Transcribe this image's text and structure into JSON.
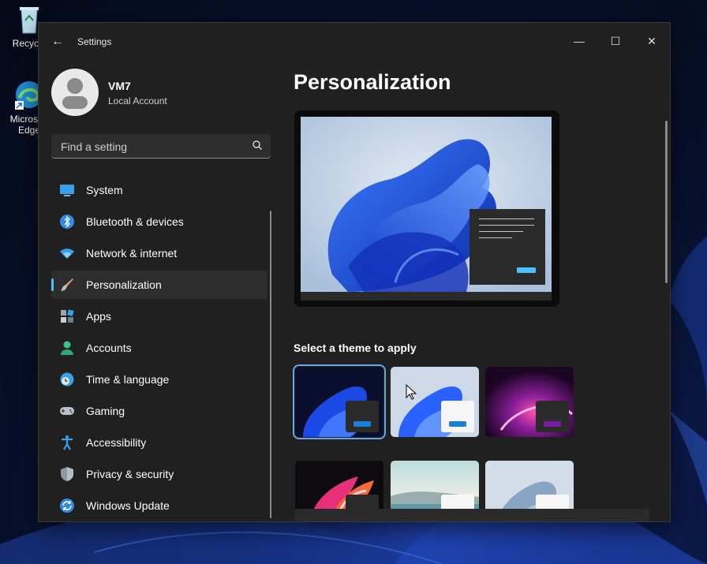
{
  "desktop": {
    "icons": [
      {
        "label": "Recycle",
        "icon": "recycle-bin-icon"
      },
      {
        "label": "Microsoft Edge",
        "icon": "edge-icon"
      }
    ]
  },
  "window": {
    "title": "Settings",
    "controls": {
      "minimize": "—",
      "maximize": "☐",
      "close": "✕"
    }
  },
  "user": {
    "name": "VM7",
    "account_type": "Local Account"
  },
  "search": {
    "placeholder": "Find a setting",
    "value": ""
  },
  "sidebar": {
    "active": "Personalization",
    "items": [
      {
        "label": "System",
        "icon": "system-icon"
      },
      {
        "label": "Bluetooth & devices",
        "icon": "bluetooth-icon"
      },
      {
        "label": "Network & internet",
        "icon": "wifi-icon"
      },
      {
        "label": "Personalization",
        "icon": "brush-icon"
      },
      {
        "label": "Apps",
        "icon": "apps-icon"
      },
      {
        "label": "Accounts",
        "icon": "person-icon"
      },
      {
        "label": "Time & language",
        "icon": "clock-globe-icon"
      },
      {
        "label": "Gaming",
        "icon": "gamepad-icon"
      },
      {
        "label": "Accessibility",
        "icon": "accessibility-icon"
      },
      {
        "label": "Privacy & security",
        "icon": "shield-icon"
      },
      {
        "label": "Windows Update",
        "icon": "update-icon"
      }
    ]
  },
  "main": {
    "title": "Personalization",
    "themes_label": "Select a theme to apply",
    "themes": [
      {
        "style": "windows-dark",
        "selected": true
      },
      {
        "style": "windows-light",
        "selected": false
      },
      {
        "style": "glow",
        "selected": false
      },
      {
        "style": "captured-motion",
        "selected": false
      },
      {
        "style": "sunrise",
        "selected": false
      },
      {
        "style": "flow",
        "selected": false
      }
    ]
  },
  "colors": {
    "accent": "#4cc2ff",
    "window_bg": "#202020",
    "selected_item_bg": "#2d2d2d"
  }
}
